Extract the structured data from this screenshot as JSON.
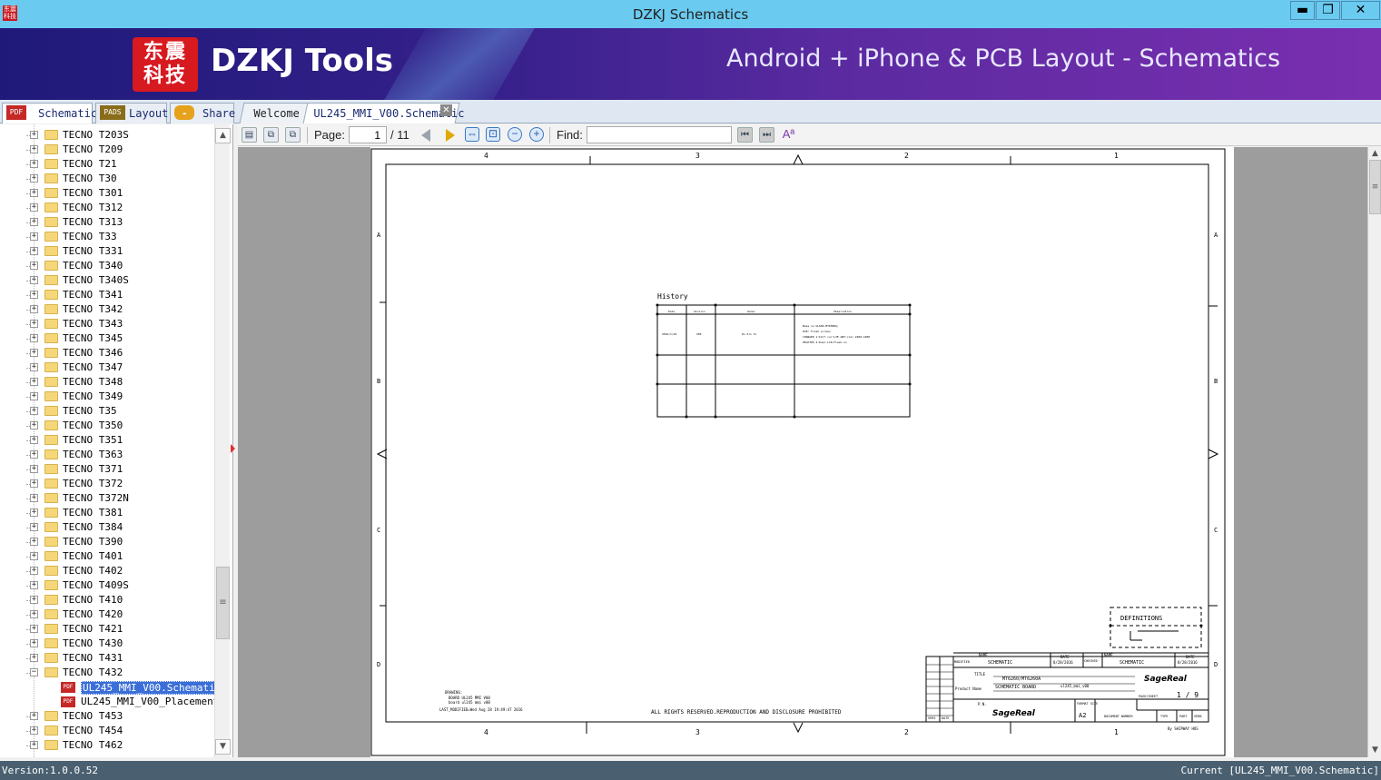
{
  "window": {
    "title": "DZKJ Schematics",
    "app_icon": "东震科技",
    "minimize": "▬",
    "maximize": "❐",
    "close": "✕"
  },
  "banner": {
    "logo_text": "东震科技",
    "brand": "DZKJ Tools",
    "tagline": "Android + iPhone & PCB Layout - Schematics"
  },
  "main_tabs": [
    {
      "label": "Schematic",
      "icon": "PDF",
      "icon_color": "#c62828"
    },
    {
      "label": "Layout",
      "icon": "PADS",
      "icon_color": "#8a6d1a"
    },
    {
      "label": "Share",
      "icon": "share-cloud-icon",
      "icon_color": "#e6a21c"
    }
  ],
  "doc_tabs": [
    {
      "label": "Welcome"
    },
    {
      "label": "UL245_MMI_V00.Schematic",
      "close": "✕"
    }
  ],
  "tree": {
    "items": [
      "TECNO T203S",
      "TECNO T209",
      "TECNO T21",
      "TECNO T30",
      "TECNO T301",
      "TECNO T312",
      "TECNO T313",
      "TECNO T33",
      "TECNO T331",
      "TECNO T340",
      "TECNO T340S",
      "TECNO T341",
      "TECNO T342",
      "TECNO T343",
      "TECNO T345",
      "TECNO T346",
      "TECNO T347",
      "TECNO T348",
      "TECNO T349",
      "TECNO T35",
      "TECNO T350",
      "TECNO T351",
      "TECNO T363",
      "TECNO T371",
      "TECNO T372",
      "TECNO T372N",
      "TECNO T381",
      "TECNO T384",
      "TECNO T390",
      "TECNO T401",
      "TECNO T402",
      "TECNO T409S",
      "TECNO T410",
      "TECNO T420",
      "TECNO T421",
      "TECNO T430",
      "TECNO T431",
      "TECNO T432"
    ],
    "children": [
      "UL245_MMI_V00.Schematic",
      "UL245_MMI_V00_Placement"
    ],
    "after": [
      "TECNO T453",
      "TECNO T454",
      "TECNO T462"
    ],
    "expanded_sign": "−",
    "collapsed_sign": "+",
    "pdf_icon": "PDF"
  },
  "toolbar": {
    "page_label": "Page:",
    "page_value": "1",
    "page_total": "/ 11",
    "find_label": "Find:",
    "find_value": ""
  },
  "schematic": {
    "cols_top": [
      "4",
      "3",
      "2",
      "1"
    ],
    "rows": [
      "A",
      "B",
      "C",
      "D"
    ],
    "history_title": "History",
    "history_headers": [
      "Date",
      "Version",
      "Owner",
      "Observation"
    ],
    "history_row": [
      "2016/1/10",
      "V00",
      "Hu Xin Yu",
      "Base on UL669-MT6580A;",
      "PCB: Fresh screen",
      "CHANGED 1:ICC? cur:LTE ANT:cxxc 2400-1000",
      "DELETED 2:Dual-LCR-Flash-nn"
    ],
    "definitions": "DEFINITIONS",
    "title_block": {
      "modified": "MODIFIED",
      "name": "NAME",
      "name_value": "SCHEMATIC",
      "date": "DATE",
      "date_value": "8/28/2016",
      "checked": "CHECKED",
      "title_label": "TITLE",
      "title_value": "MT6260/MT6260A",
      "product_label": "Product Name",
      "product_value": "SCHEMATIC BOARD",
      "drawing_id": "ul245_mmi_v00",
      "pn": "P.N.",
      "page_sheet": "PAGE/SHEET",
      "page_sheet_value": "1 / 9",
      "format": "FORMAT SIZE",
      "format_value": "A2",
      "doc_number": "DOCUMENT NUMBER",
      "type": "TYPE",
      "part": "PART",
      "verb": "VERB",
      "vers": "VERS",
      "date2": "DATE",
      "company": "SageReal",
      "footer": "By SHIPWAY HOS"
    },
    "drawing_note": [
      "DRAWING:",
      "BOARD UL245 MMI V00",
      "board ul245 mmi v00"
    ],
    "last_modified": "LAST_MODIFIED=Wed Aug 28 19:49:47 2016",
    "rights": "ALL RIGHTS RESERVED.REPRODUCTION AND DISCLOSURE PROHIBITED"
  },
  "status": {
    "version": "Version:1.0.0.52",
    "current": "Current [UL245_MMI_V00.Schematic]"
  }
}
